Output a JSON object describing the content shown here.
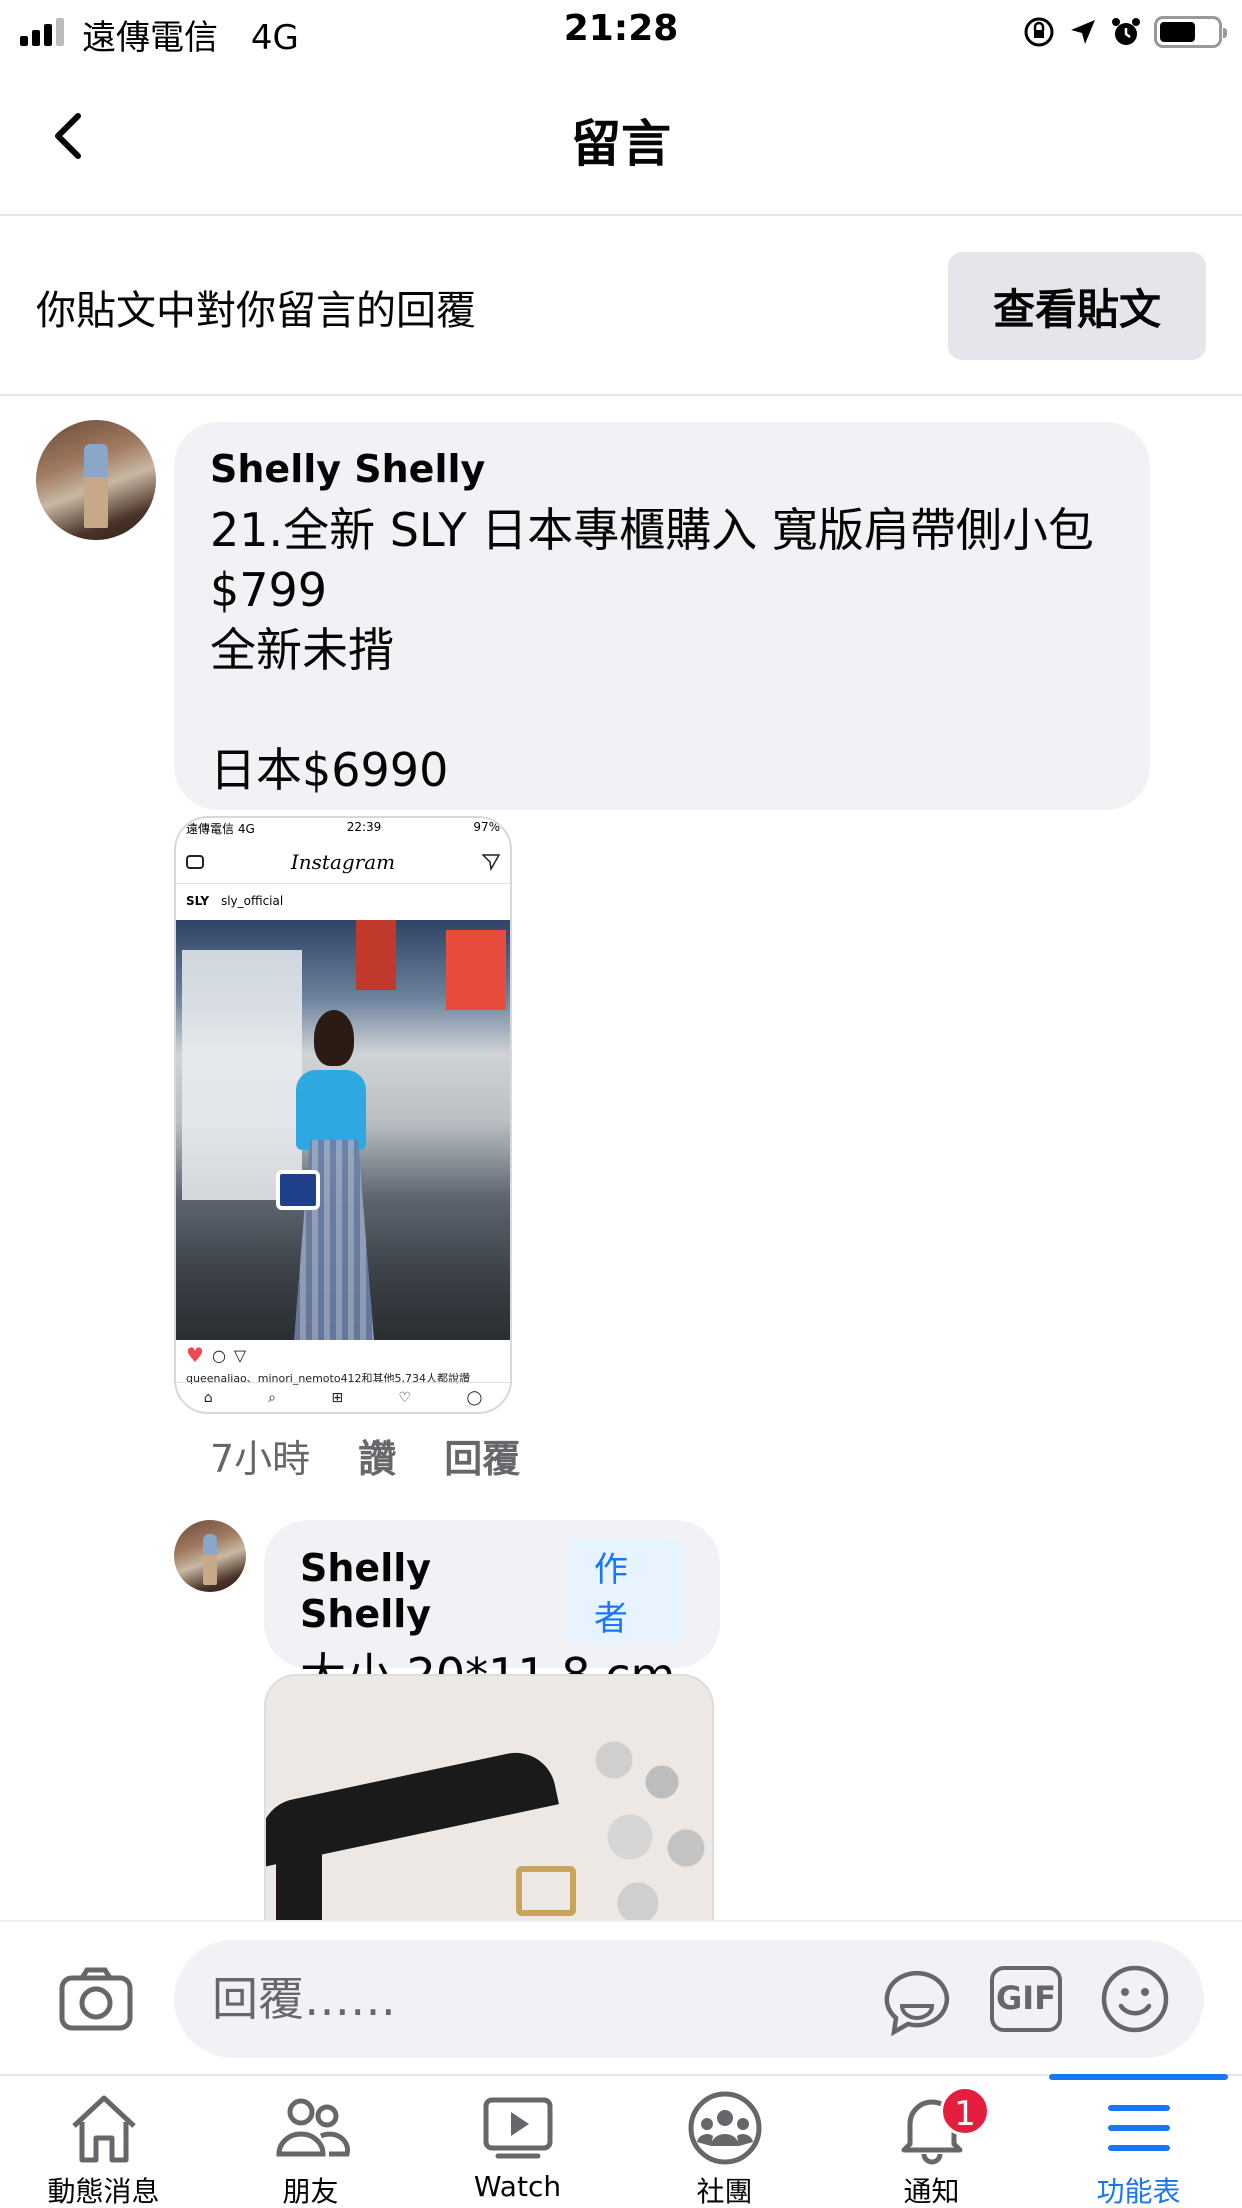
{
  "status_bar": {
    "carrier": "遠傳電信",
    "network": "4G",
    "time": "21:28",
    "battery_level": 0.62
  },
  "header": {
    "title": "留言"
  },
  "context": {
    "text": "你貼文中對你留言的回覆",
    "view_post_label": "查看貼文"
  },
  "comment": {
    "author": "Shelly Shelly",
    "text": "21.全新 SLY 日本專櫃購入 寬版肩帶側小包\n$799\n全新未揹\n\n日本$6990",
    "attachment": {
      "status_carrier": "遠傳電信 4G",
      "status_time": "22:39",
      "status_battery": "97%",
      "app_name": "Instagram",
      "account_badge": "SLY",
      "account": "sly_official",
      "likes_text": "queenaliao、minori_nemoto412和其他5,734人都說讚"
    },
    "time_ago": "7小時",
    "like_label": "讚",
    "reply_label": "回覆"
  },
  "reply": {
    "author": "Shelly Shelly",
    "badge": "作者",
    "text": "大小 20*11.8 cm"
  },
  "composer": {
    "placeholder": "回覆……",
    "gif_label": "GIF"
  },
  "tabbar": {
    "tabs": [
      {
        "label": "動態消息",
        "icon": "home-icon"
      },
      {
        "label": "朋友",
        "icon": "friends-icon"
      },
      {
        "label": "Watch",
        "icon": "watch-icon"
      },
      {
        "label": "社團",
        "icon": "groups-icon"
      },
      {
        "label": "通知",
        "icon": "bell-icon"
      },
      {
        "label": "功能表",
        "icon": "menu-icon"
      }
    ],
    "active_tab": "功能表",
    "notification_count": "1"
  },
  "colors": {
    "accent": "#1877f2",
    "bubble": "#f0f2f5",
    "badge_red": "#e41e3f"
  }
}
